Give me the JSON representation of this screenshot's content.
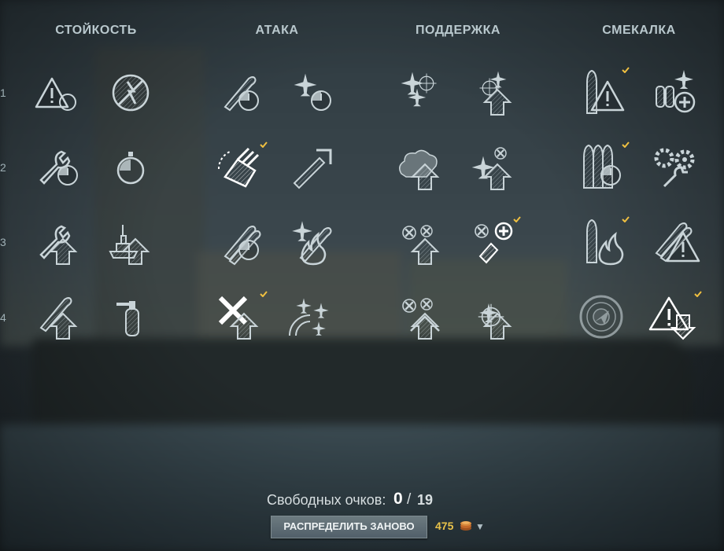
{
  "columns": [
    {
      "title": "СТОЙКОСТЬ"
    },
    {
      "title": "АТАКА"
    },
    {
      "title": "ПОДДЕРЖКА"
    },
    {
      "title": "СМЕКАЛКА"
    }
  ],
  "rows": [
    "1",
    "2",
    "3",
    "4"
  ],
  "skills": {
    "c0r1a": {
      "icon": "warning-timer-icon",
      "selected": false
    },
    "c0r1b": {
      "icon": "no-fire-crossed-icon",
      "selected": false
    },
    "c0r2a": {
      "icon": "wrench-timer-icon",
      "selected": false
    },
    "c0r2b": {
      "icon": "stopwatch-icon",
      "selected": false
    },
    "c0r3a": {
      "icon": "wrench-upgrade-icon",
      "selected": false
    },
    "c0r3b": {
      "icon": "ship-upgrade-icon",
      "selected": false
    },
    "c0r4a": {
      "icon": "torpedo-upgrade-icon",
      "selected": false
    },
    "c0r4b": {
      "icon": "extinguisher-icon",
      "selected": false
    },
    "c1r1a": {
      "icon": "torpedo-timer-icon",
      "selected": false
    },
    "c1r1b": {
      "icon": "plane-timer-icon",
      "selected": false
    },
    "c1r2a": {
      "icon": "turret-rotation-icon",
      "selected": true
    },
    "c1r2b": {
      "icon": "shell-range-icon",
      "selected": false
    },
    "c1r3a": {
      "icon": "torpedo-reload-icon",
      "selected": false
    },
    "c1r3b": {
      "icon": "plane-fire-icon",
      "selected": false
    },
    "c1r4a": {
      "icon": "crossed-guns-upgrade-icon",
      "selected": true
    },
    "c1r4b": {
      "icon": "planes-grid-icon",
      "selected": false
    },
    "c2r1a": {
      "icon": "planes-target-icon",
      "selected": false
    },
    "c2r1b": {
      "icon": "aa-target-upgrade-icon",
      "selected": false
    },
    "c2r2a": {
      "icon": "smoke-upgrade-icon",
      "selected": false
    },
    "c2r2b": {
      "icon": "fighter-upgrade-icon",
      "selected": false
    },
    "c2r3a": {
      "icon": "aa-shells-upgrade-icon",
      "selected": false
    },
    "c2r3b": {
      "icon": "aa-plus-icon",
      "selected": true
    },
    "c2r4a": {
      "icon": "aa-double-upgrade-icon",
      "selected": false
    },
    "c2r4b": {
      "icon": "crosshair-plane-icon",
      "selected": false
    },
    "c3r1a": {
      "icon": "shell-warning-icon",
      "selected": true
    },
    "c3r1b": {
      "icon": "bombs-plane-plus-icon",
      "selected": false
    },
    "c3r2a": {
      "icon": "shells-timer-icon",
      "selected": true
    },
    "c3r2b": {
      "icon": "gears-wrench-icon",
      "selected": false
    },
    "c3r3a": {
      "icon": "shell-fire-icon",
      "selected": true
    },
    "c3r3b": {
      "icon": "torpedo-warning-icon",
      "selected": false
    },
    "c3r4a": {
      "icon": "radar-icon",
      "selected": false
    },
    "c3r4b": {
      "icon": "warning-down-icon",
      "selected": true
    }
  },
  "footer": {
    "free_points_label": "Свободных очков:",
    "points_current": "0",
    "points_separator": "/",
    "points_max": "19",
    "reset_button": "РАСПРЕДЕЛИТЬ ЗАНОВО",
    "reset_price": "475",
    "currency_icon": "doubloon-coin-icon",
    "expand_icon": "arrow-down-icon"
  },
  "colors": {
    "selected_icon": "#ffffff",
    "unselected_icon": "#c9d4d8",
    "check": "#f0c040",
    "price": "#e8c24a"
  }
}
